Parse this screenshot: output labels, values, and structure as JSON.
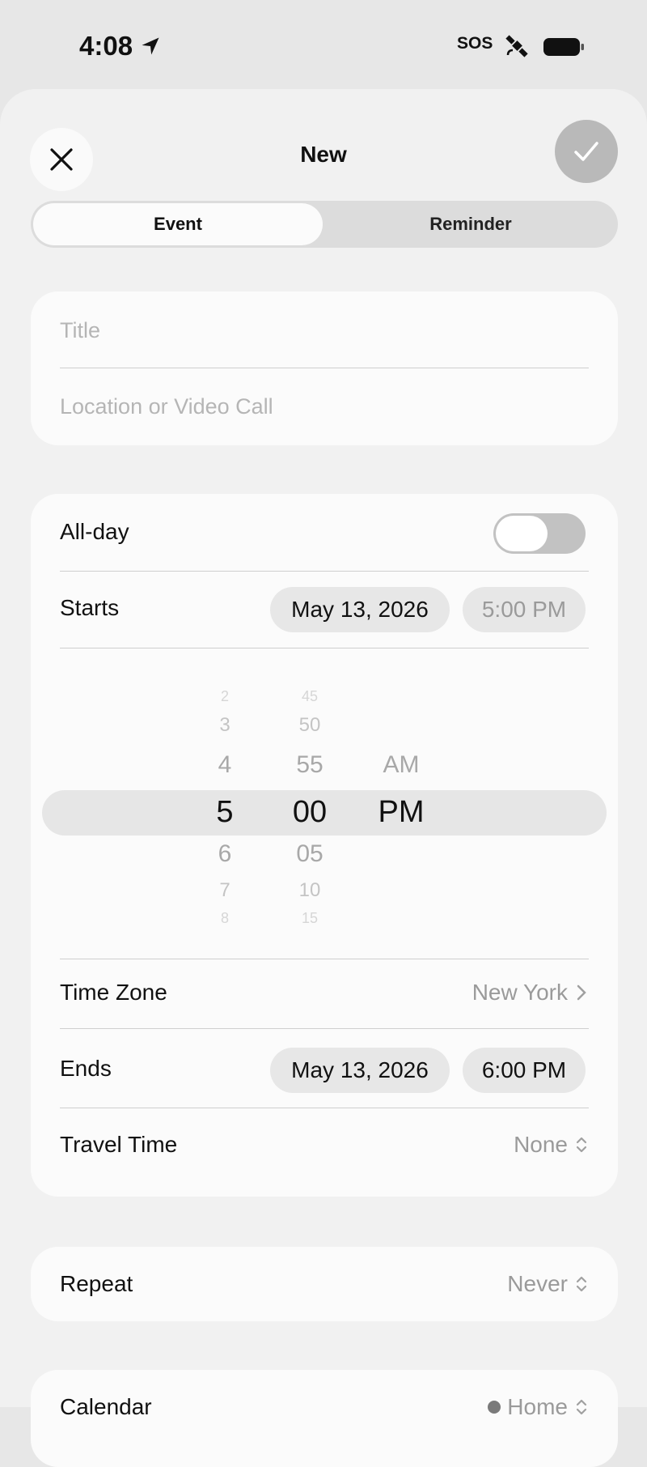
{
  "status_bar": {
    "time": "4:08",
    "carrier": "SOS",
    "icons": [
      "location-arrow-icon",
      "satellite-icon",
      "battery-icon"
    ]
  },
  "header": {
    "title": "New",
    "close_icon": "close-icon",
    "confirm_icon": "checkmark-icon"
  },
  "segments": {
    "event": "Event",
    "reminder": "Reminder",
    "selected": "Event"
  },
  "form": {
    "title_placeholder": "Title",
    "location_placeholder": "Location or Video Call"
  },
  "all_day": {
    "label": "All-day",
    "on": false
  },
  "starts": {
    "label": "Starts",
    "date": "May 13, 2026",
    "time": "5:00 PM"
  },
  "picker": {
    "hours": [
      "2",
      "3",
      "4",
      "5",
      "6",
      "7",
      "8"
    ],
    "minutes": [
      "45",
      "50",
      "55",
      "00",
      "05",
      "10",
      "15"
    ],
    "periods": [
      "AM",
      "PM"
    ],
    "selected": {
      "hour": "5",
      "minute": "00",
      "period": "PM"
    }
  },
  "time_zone": {
    "label": "Time Zone",
    "value": "New York"
  },
  "ends": {
    "label": "Ends",
    "date": "May 13, 2026",
    "time": "6:00 PM"
  },
  "travel_time": {
    "label": "Travel Time",
    "value": "None"
  },
  "repeat": {
    "label": "Repeat",
    "value": "Never"
  },
  "calendar": {
    "label": "Calendar",
    "value": "Home"
  },
  "colors": {
    "background": "#e7e7e7",
    "card": "#fbfbfb",
    "muted_text": "#9a9a9a"
  }
}
